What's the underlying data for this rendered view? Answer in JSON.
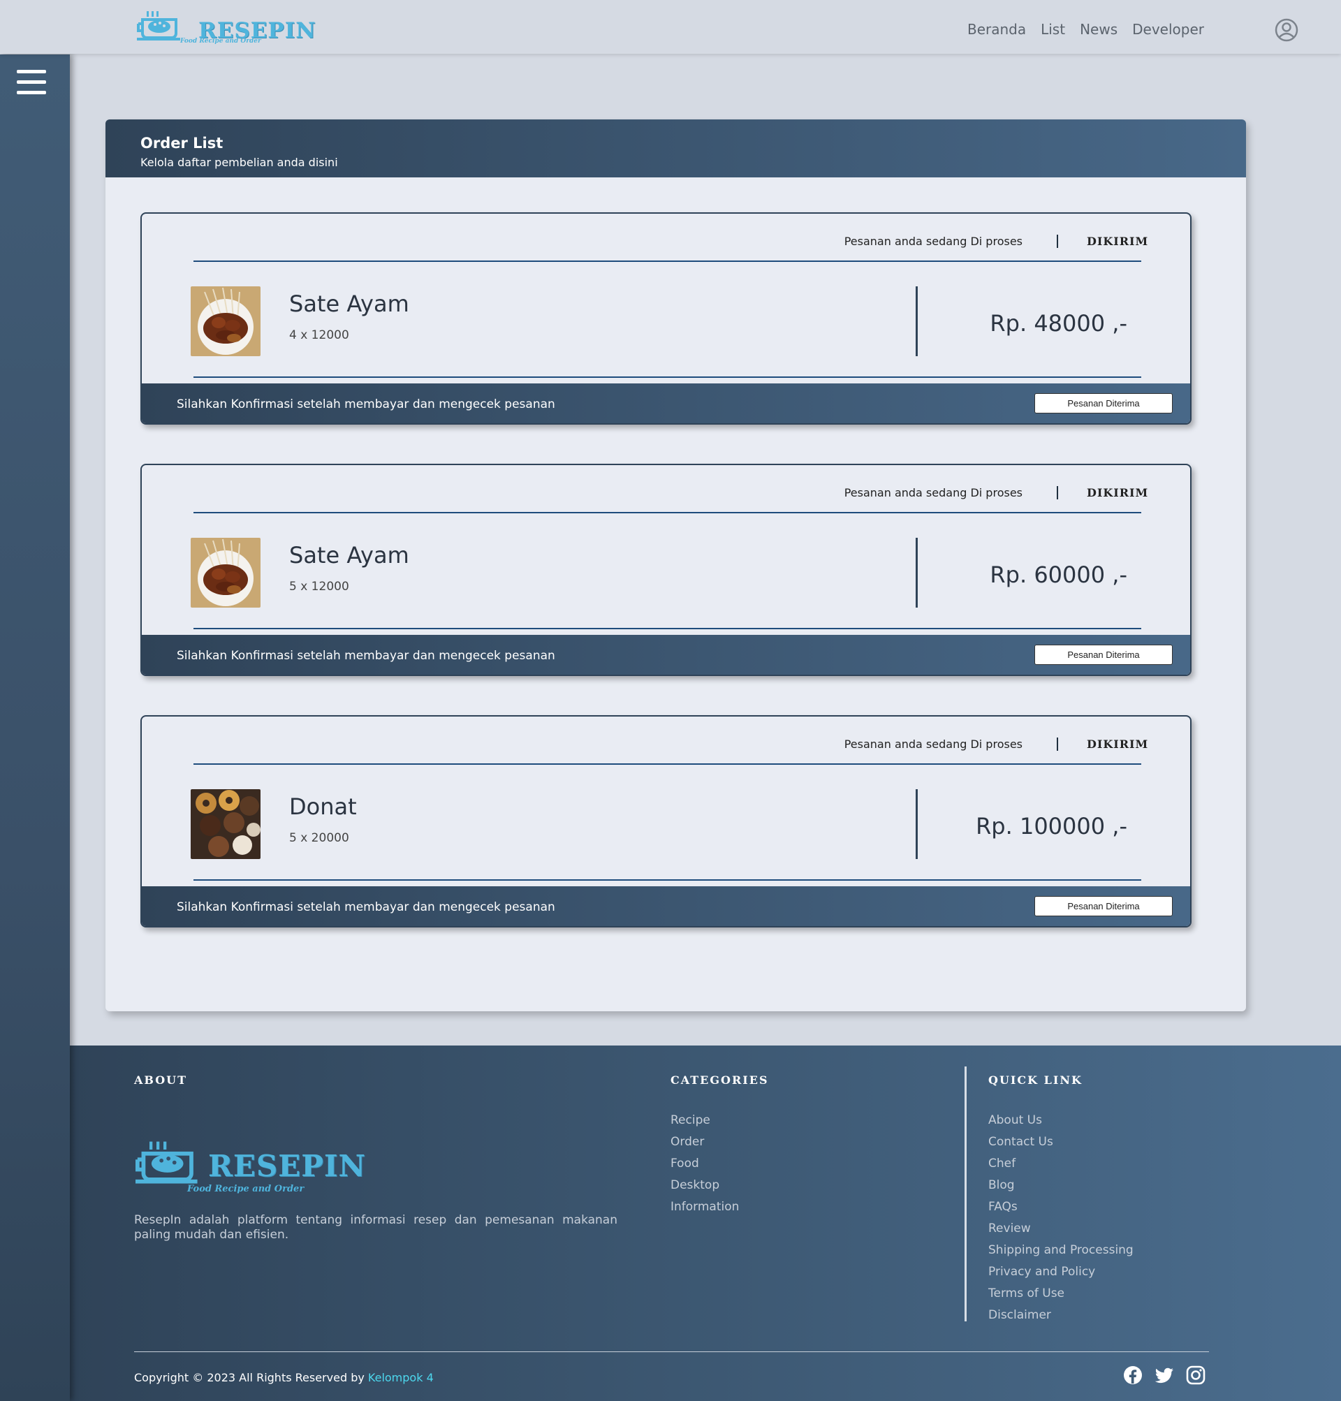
{
  "brand": {
    "name": "RESEPIN",
    "tagline": "Food Recipe and Order"
  },
  "nav": {
    "links": [
      "Beranda",
      "List",
      "News",
      "Developer"
    ]
  },
  "order_list": {
    "title": "Order List",
    "subtitle": "Kelola daftar pembelian anda disini",
    "orders": [
      {
        "status_text": "Pesanan anda sedang Di proses",
        "status_badge": "DIKIRIM",
        "name": "Sate Ayam",
        "qty": "4 x 12000",
        "price": "Rp. 48000 ,-",
        "footer_text": "Silahkan Konfirmasi setelah membayar dan mengecek pesanan",
        "button_label": "Pesanan Diterima"
      },
      {
        "status_text": "Pesanan anda sedang Di proses",
        "status_badge": "DIKIRIM",
        "name": "Sate Ayam",
        "qty": "5 x 12000",
        "price": "Rp. 60000 ,-",
        "footer_text": "Silahkan Konfirmasi setelah membayar dan mengecek pesanan",
        "button_label": "Pesanan Diterima"
      },
      {
        "status_text": "Pesanan anda sedang Di proses",
        "status_badge": "DIKIRIM",
        "name": "Donat",
        "qty": "5 x 20000",
        "price": "Rp. 100000 ,-",
        "footer_text": "Silahkan Konfirmasi setelah membayar dan mengecek pesanan",
        "button_label": "Pesanan Diterima"
      }
    ]
  },
  "footer": {
    "about_heading": "ABOUT",
    "about_text": "ResepIn adalah platform tentang informasi resep dan pemesanan makanan paling mudah dan efisien.",
    "categories_heading": "CATEGORIES",
    "categories": [
      "Recipe",
      "Order",
      "Food",
      "Desktop",
      "Information"
    ],
    "quicklink_heading": "QUICK LINK",
    "quicklinks": [
      "About Us",
      "Contact Us",
      "Chef",
      "Blog",
      "FAQs",
      "Review",
      "Shipping and Processing",
      "Privacy and Policy",
      "Terms of Use",
      "Disclaimer"
    ],
    "copyright": "Copyright © 2023 All Rights Reserved by",
    "copyright_by": "Kelompok 4"
  },
  "icons": {
    "account": "user-circle-icon",
    "menu": "hamburger-menu-icon",
    "social": [
      "facebook-icon",
      "twitter-icon",
      "instagram-icon"
    ]
  },
  "colors": {
    "page_bg": "#d5dae3",
    "panel_bg": "#e9ecf3",
    "header_dark": "#2f4358",
    "header_light": "#486888",
    "accent_blue": "#4fb4dc",
    "link_cyan": "#4dd8ee",
    "divider_blue": "#1e4c7c"
  }
}
